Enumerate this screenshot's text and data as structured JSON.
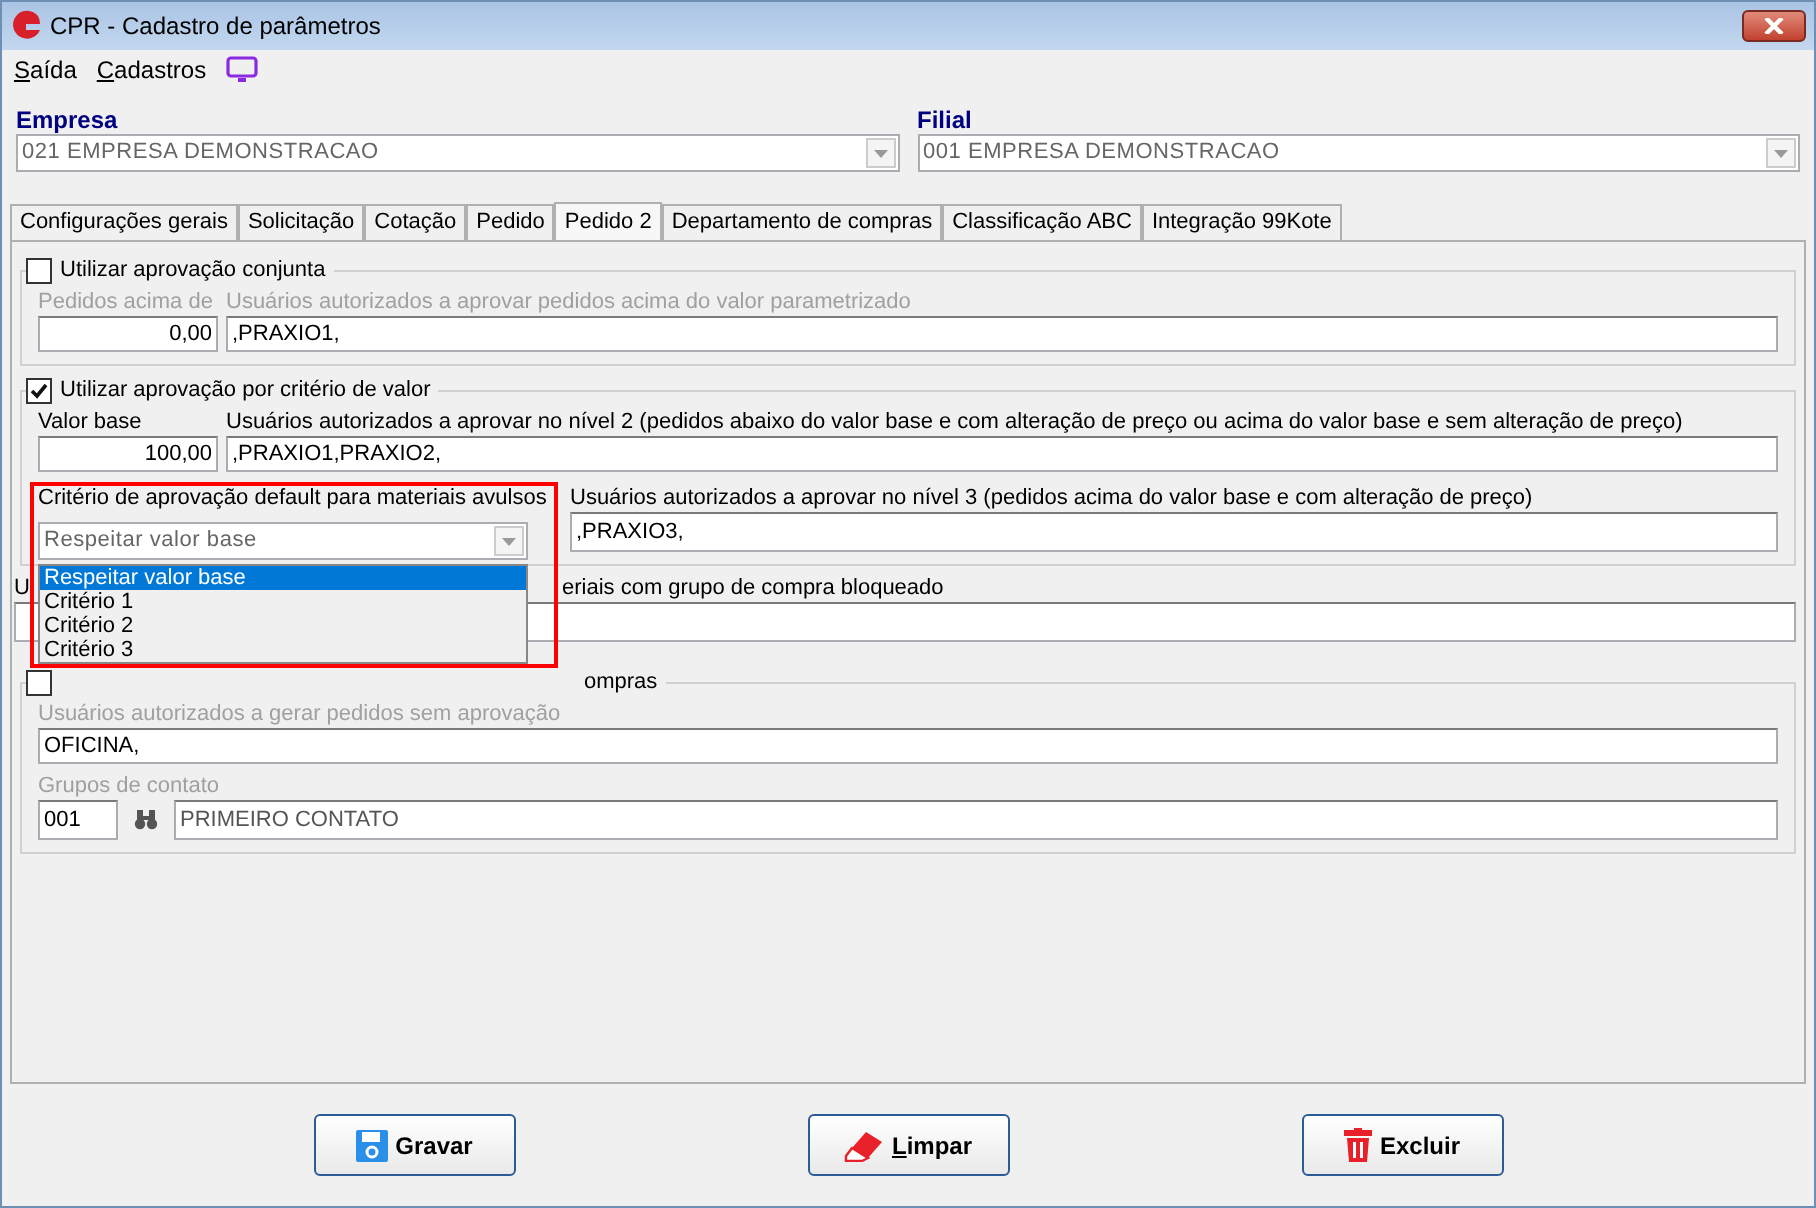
{
  "window": {
    "title": "CPR - Cadastro de parâmetros"
  },
  "menu": [
    {
      "label": "Saída",
      "underline_first": true
    },
    {
      "label": "Cadastros",
      "underline_first": true
    }
  ],
  "empresa": {
    "label": "Empresa",
    "value": "021 EMPRESA DEMONSTRACAO"
  },
  "filial": {
    "label": "Filial",
    "value": "001 EMPRESA DEMONSTRACAO"
  },
  "tabs": [
    {
      "label": "Configurações gerais",
      "selected": false
    },
    {
      "label": "Solicitação",
      "selected": false
    },
    {
      "label": "Cotação",
      "selected": false
    },
    {
      "label": "Pedido",
      "selected": false
    },
    {
      "label": "Pedido 2",
      "selected": true
    },
    {
      "label": "Departamento de compras",
      "selected": false
    },
    {
      "label": "Classificação ABC",
      "selected": false
    },
    {
      "label": "Integração 99Kote",
      "selected": false
    }
  ],
  "group_conjunta": {
    "label": "Utilizar aprovação conjunta",
    "checked": false,
    "amount_label": "Pedidos acima de",
    "amount": "0,00",
    "users_label": "Usuários autorizados a aprovar pedidos acima do valor parametrizado",
    "users": ",PRAXIO1,"
  },
  "group_valor": {
    "label": "Utilizar aprovação por critério de valor",
    "checked": true,
    "base_label": "Valor base",
    "base": "100,00",
    "level2_label": "Usuários autorizados a aprovar no nível 2 (pedidos abaixo do valor base e com alteração de preço ou acima do valor base e sem alteração de preço)",
    "level2": ",PRAXIO1,PRAXIO2,",
    "criterion_label": "Critério de aprovação default para materiais avulsos",
    "criterion": "Respeitar valor base",
    "level3_label": "Usuários autorizados a aprovar no nível 3 (pedidos acima do valor base e com alteração de preço)",
    "level3": ",PRAXIO3,"
  },
  "criterion_options": [
    {
      "label": "Respeitar valor base",
      "selected": true
    },
    {
      "label": "Critério 1",
      "selected": false
    },
    {
      "label": "Critério 2",
      "selected": false
    },
    {
      "label": "Critério 3",
      "selected": false
    }
  ],
  "blocked_group": {
    "label_start": "U",
    "label_end": "eriais com grupo de compra bloqueado"
  },
  "group_fora": {
    "label_end": "ompras",
    "checked": false,
    "users_label": "Usuários autorizados a gerar pedidos sem aprovação",
    "users": "OFICINA,",
    "contact_label": "Grupos de contato",
    "contact_code": "001",
    "contact_name": "PRIMEIRO CONTATO"
  },
  "buttons": [
    {
      "kind": "save",
      "label": "Gravar",
      "underline_first": false
    },
    {
      "kind": "clear",
      "label": "Limpar",
      "underline_first": true
    },
    {
      "kind": "delete",
      "label": "Excluir",
      "underline_first": false
    }
  ]
}
